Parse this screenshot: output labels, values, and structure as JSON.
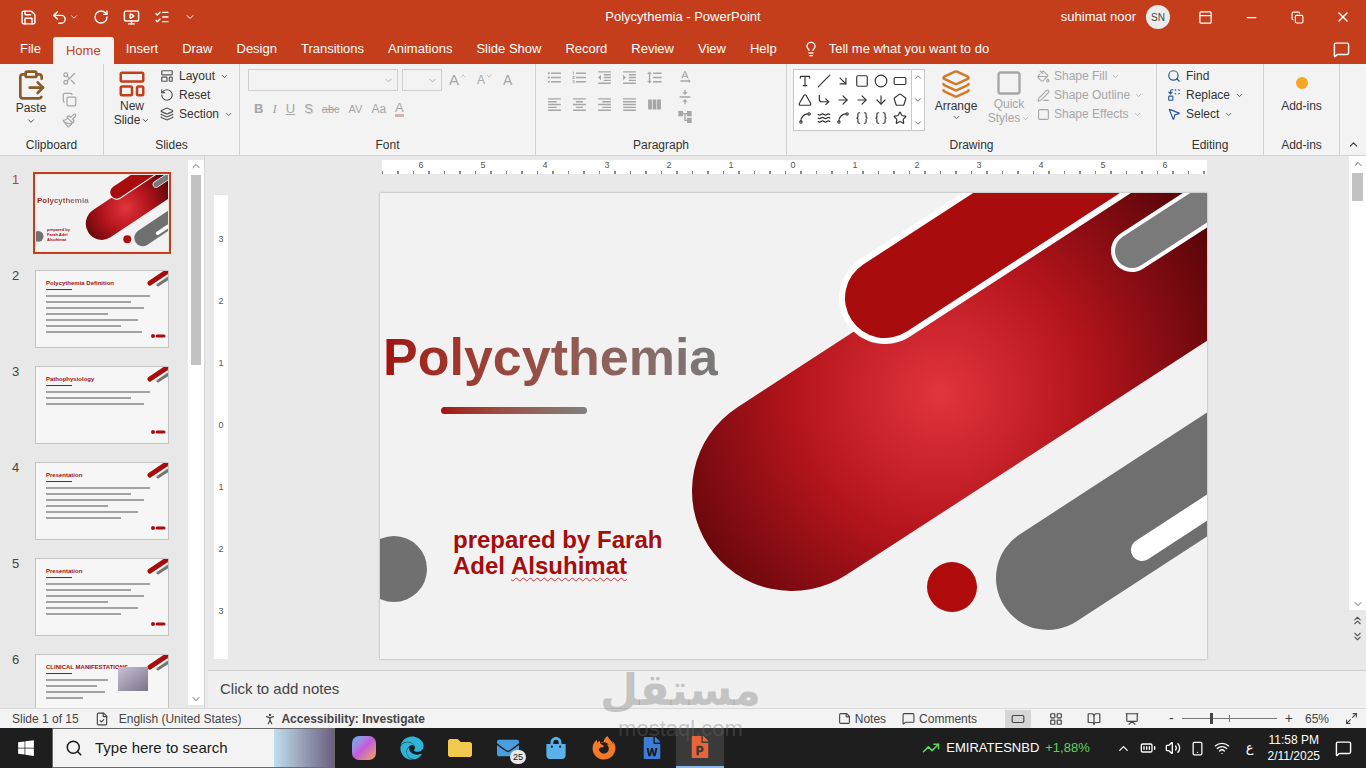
{
  "title_bar": {
    "title": "Polycythemia - PowerPoint",
    "user": "suhimat noor",
    "initials": "SN"
  },
  "menu_tabs": [
    {
      "label": "File",
      "selected": false
    },
    {
      "label": "Home",
      "selected": true
    },
    {
      "label": "Insert",
      "selected": false
    },
    {
      "label": "Draw",
      "selected": false
    },
    {
      "label": "Design",
      "selected": false
    },
    {
      "label": "Transitions",
      "selected": false
    },
    {
      "label": "Animations",
      "selected": false
    },
    {
      "label": "Slide Show",
      "selected": false
    },
    {
      "label": "Record",
      "selected": false
    },
    {
      "label": "Review",
      "selected": false
    },
    {
      "label": "View",
      "selected": false
    },
    {
      "label": "Help",
      "selected": false
    }
  ],
  "tell_me": "Tell me what you want to do",
  "ribbon": {
    "clipboard": {
      "label": "Clipboard",
      "paste": "Paste"
    },
    "slides": {
      "label": "Slides",
      "new_slide": [
        "New",
        "Slide"
      ],
      "items": [
        "Layout",
        "Reset",
        "Section"
      ]
    },
    "font": {
      "label": "Font",
      "disabled": true,
      "sizing": [
        {
          "text": "A",
          "kind": "grow"
        },
        {
          "text": "A",
          "kind": "shrink"
        },
        {
          "text": "A",
          "kind": "clear"
        }
      ],
      "styles": [
        {
          "text": "B",
          "kind": "bold"
        },
        {
          "text": "I",
          "kind": "italic"
        },
        {
          "text": "U",
          "kind": "underline"
        },
        {
          "text": "S",
          "kind": "shadow"
        },
        {
          "text": "abc",
          "kind": "strike"
        },
        {
          "text": "AV",
          "kind": "spacing"
        },
        {
          "text": "Aa",
          "kind": "case"
        },
        {
          "text": "A",
          "kind": "color"
        }
      ]
    },
    "paragraph": {
      "label": "Paragraph",
      "disabled": true
    },
    "drawing": {
      "label": "Drawing",
      "arrange": "Arrange",
      "quick_styles": [
        "Quick",
        "Styles"
      ],
      "quick_styles_disabled": true,
      "shape_format": [
        {
          "label": "Shape Fill",
          "disabled": true
        },
        {
          "label": "Shape Outline",
          "disabled": true
        },
        {
          "label": "Shape Effects",
          "disabled": true
        }
      ]
    },
    "editing": {
      "label": "Editing",
      "items": [
        "Find",
        "Replace",
        "Select"
      ]
    },
    "addins": {
      "label": "Add-ins",
      "button": "Add-ins"
    }
  },
  "ruler": {
    "horizontal": [
      "6",
      "5",
      "4",
      "3",
      "2",
      "1",
      "0",
      "1",
      "2",
      "3",
      "4",
      "5",
      "6"
    ],
    "vertical": [
      "3",
      "2",
      "1",
      "0",
      "1",
      "2",
      "3"
    ]
  },
  "thumbnails": [
    {
      "number": "1",
      "selected": true,
      "kind": "title",
      "title": "Polycythemia",
      "subtitle": "prepared by Farah Adel Alsuhimat"
    },
    {
      "number": "2",
      "selected": false,
      "kind": "content",
      "title": "Polycythemia Definition",
      "lines": 7
    },
    {
      "number": "3",
      "selected": false,
      "kind": "content",
      "title": "Pathophysiology",
      "lines": 3
    },
    {
      "number": "4",
      "selected": false,
      "kind": "content",
      "title": "Presentation",
      "lines": 6
    },
    {
      "number": "5",
      "selected": false,
      "kind": "content",
      "title": "Presentation",
      "lines": 6
    },
    {
      "number": "6",
      "selected": false,
      "kind": "image",
      "title": "CLINICAL MANIFESTATIONS",
      "lines": 4
    }
  ],
  "slide": {
    "title": "Polycythemia",
    "subtitle": [
      [
        {
          "text": "prepared by Farah",
          "misspelled": false
        }
      ],
      [
        {
          "text": "Adel",
          "misspelled": false
        },
        {
          "text": "Alsuhimat",
          "misspelled": true
        }
      ]
    ]
  },
  "notes": {
    "placeholder": "Click to add notes"
  },
  "status_bar": {
    "slide": "Slide 1 of 15",
    "language": "English (United States)",
    "accessibility": "Accessibility: Investigate",
    "notes": "Notes",
    "comments": "Comments",
    "views": [
      {
        "kind": "normal",
        "selected": true
      },
      {
        "kind": "sorter",
        "selected": false
      },
      {
        "kind": "reading",
        "selected": false
      },
      {
        "kind": "slideshow",
        "selected": false
      }
    ],
    "zoom_out": "-",
    "zoom_in": "+",
    "zoom_level": 0.3,
    "zoom": "65%"
  },
  "taskbar": {
    "search_placeholder": "Type here to search",
    "apps": [
      {
        "kind": "copilot",
        "active": false,
        "badge": ""
      },
      {
        "kind": "edge",
        "active": false,
        "badge": ""
      },
      {
        "kind": "explorer",
        "active": false,
        "badge": ""
      },
      {
        "kind": "mail",
        "active": false,
        "badge": "25"
      },
      {
        "kind": "store",
        "active": false,
        "badge": ""
      },
      {
        "kind": "firefox",
        "active": false,
        "badge": ""
      },
      {
        "kind": "word",
        "active": false,
        "badge": ""
      },
      {
        "kind": "powerpoint",
        "active": true,
        "badge": ""
      }
    ],
    "stock": {
      "name": "EMIRATESNBD",
      "change": "+1,88%"
    },
    "input_language": "ع",
    "time": "11:58 PM",
    "date": "2/11/2025"
  },
  "watermark": {
    "arabic": "مستقل",
    "latin": "mostaql.com"
  }
}
